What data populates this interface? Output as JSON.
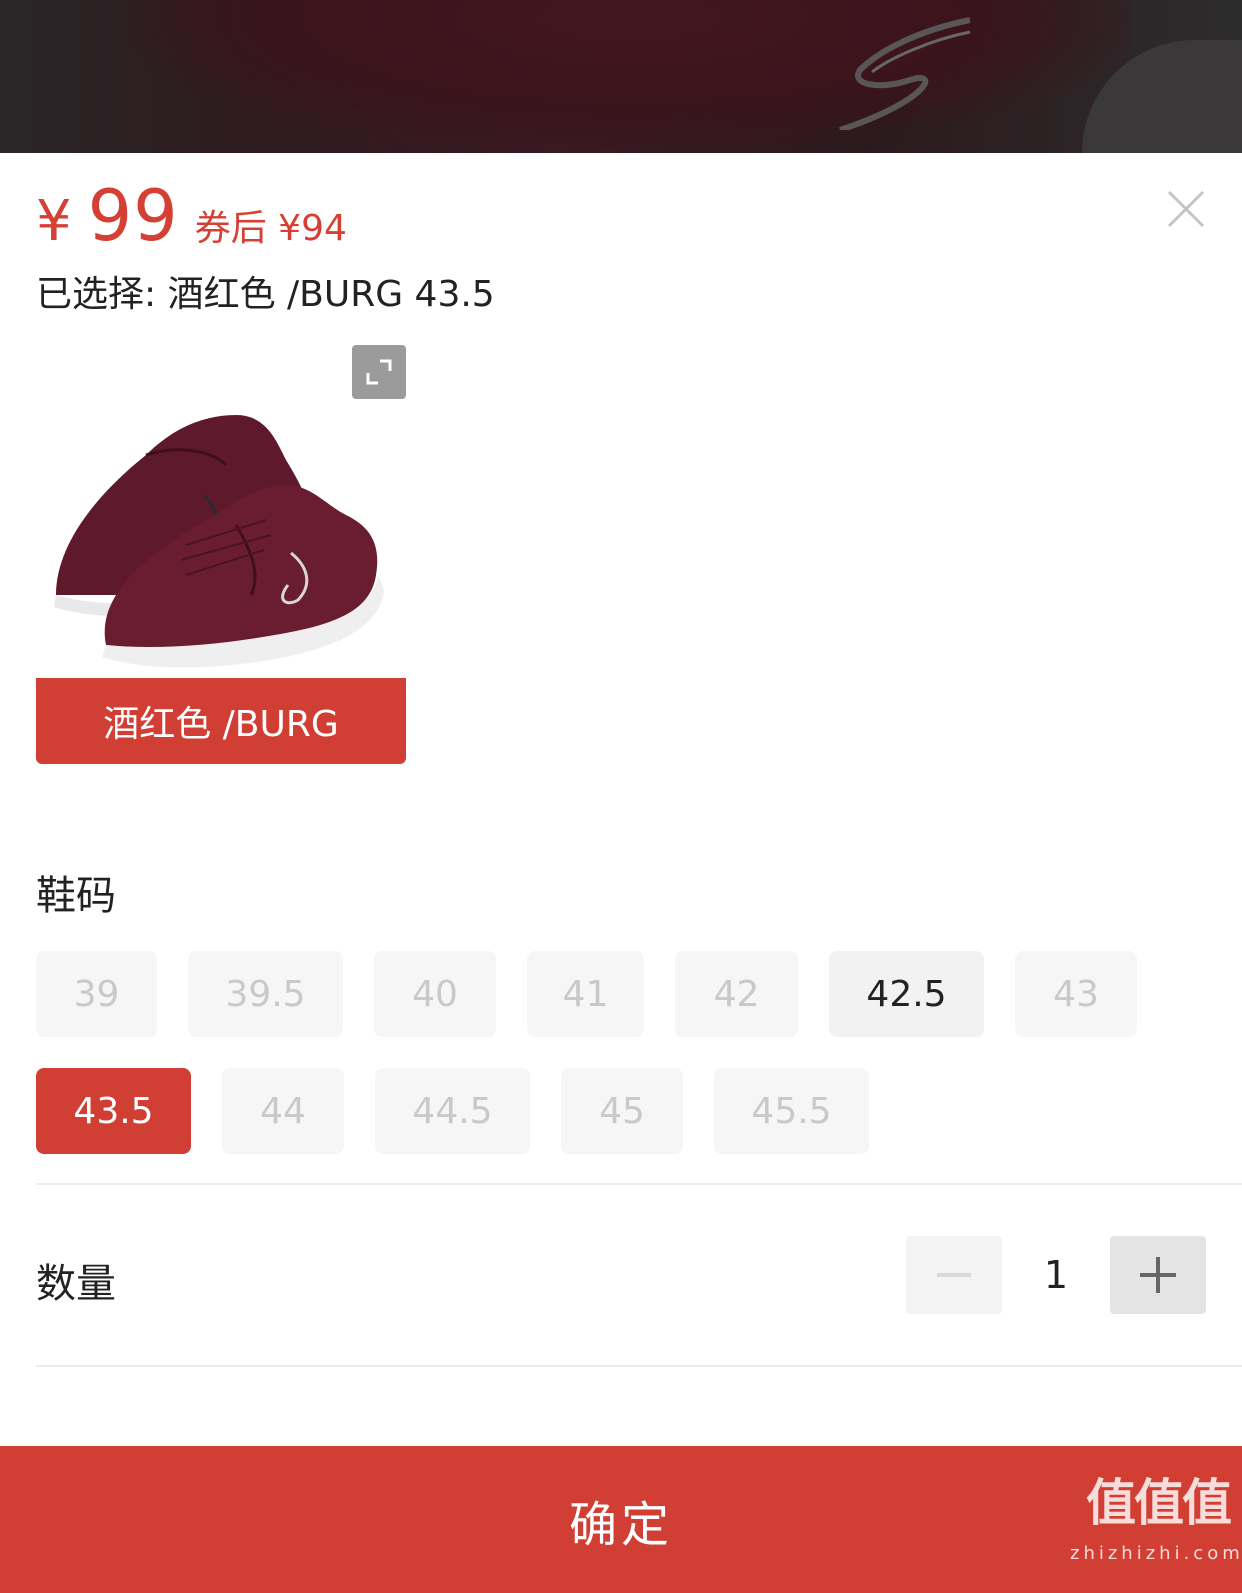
{
  "colors": {
    "accent": "#d13e33",
    "price_red": "#d53f34",
    "chip_disabled_bg": "#f6f6f6",
    "chip_disabled_text": "#c9c9c9",
    "text_primary": "#222222"
  },
  "header": {
    "price_symbol": "¥",
    "price": "99",
    "coupon_price": "券后 ¥94",
    "close_icon": "close-icon"
  },
  "selection": {
    "summary": "已选择: 酒红色 /BURG 43.5"
  },
  "variant": {
    "label": "酒红色 /BURG",
    "image_icon": "shoe-image",
    "expand_icon": "expand-icon"
  },
  "sizes": {
    "title": "鞋码",
    "rows": [
      [
        {
          "label": "39",
          "state": "disabled"
        },
        {
          "label": "39.5",
          "state": "disabled"
        },
        {
          "label": "40",
          "state": "disabled"
        },
        {
          "label": "41",
          "state": "disabled"
        },
        {
          "label": "42",
          "state": "disabled"
        },
        {
          "label": "42.5",
          "state": "available"
        },
        {
          "label": "43",
          "state": "disabled"
        }
      ],
      [
        {
          "label": "43.5",
          "state": "selected"
        },
        {
          "label": "44",
          "state": "disabled"
        },
        {
          "label": "44.5",
          "state": "disabled"
        },
        {
          "label": "45",
          "state": "disabled"
        },
        {
          "label": "45.5",
          "state": "disabled"
        }
      ]
    ]
  },
  "quantity": {
    "title": "数量",
    "value": "1",
    "minus_icon": "minus-icon",
    "plus_icon": "plus-icon"
  },
  "footer": {
    "confirm_label": "确定",
    "watermark_main": "值值值",
    "watermark_sub": "zhizhizhi.com"
  }
}
